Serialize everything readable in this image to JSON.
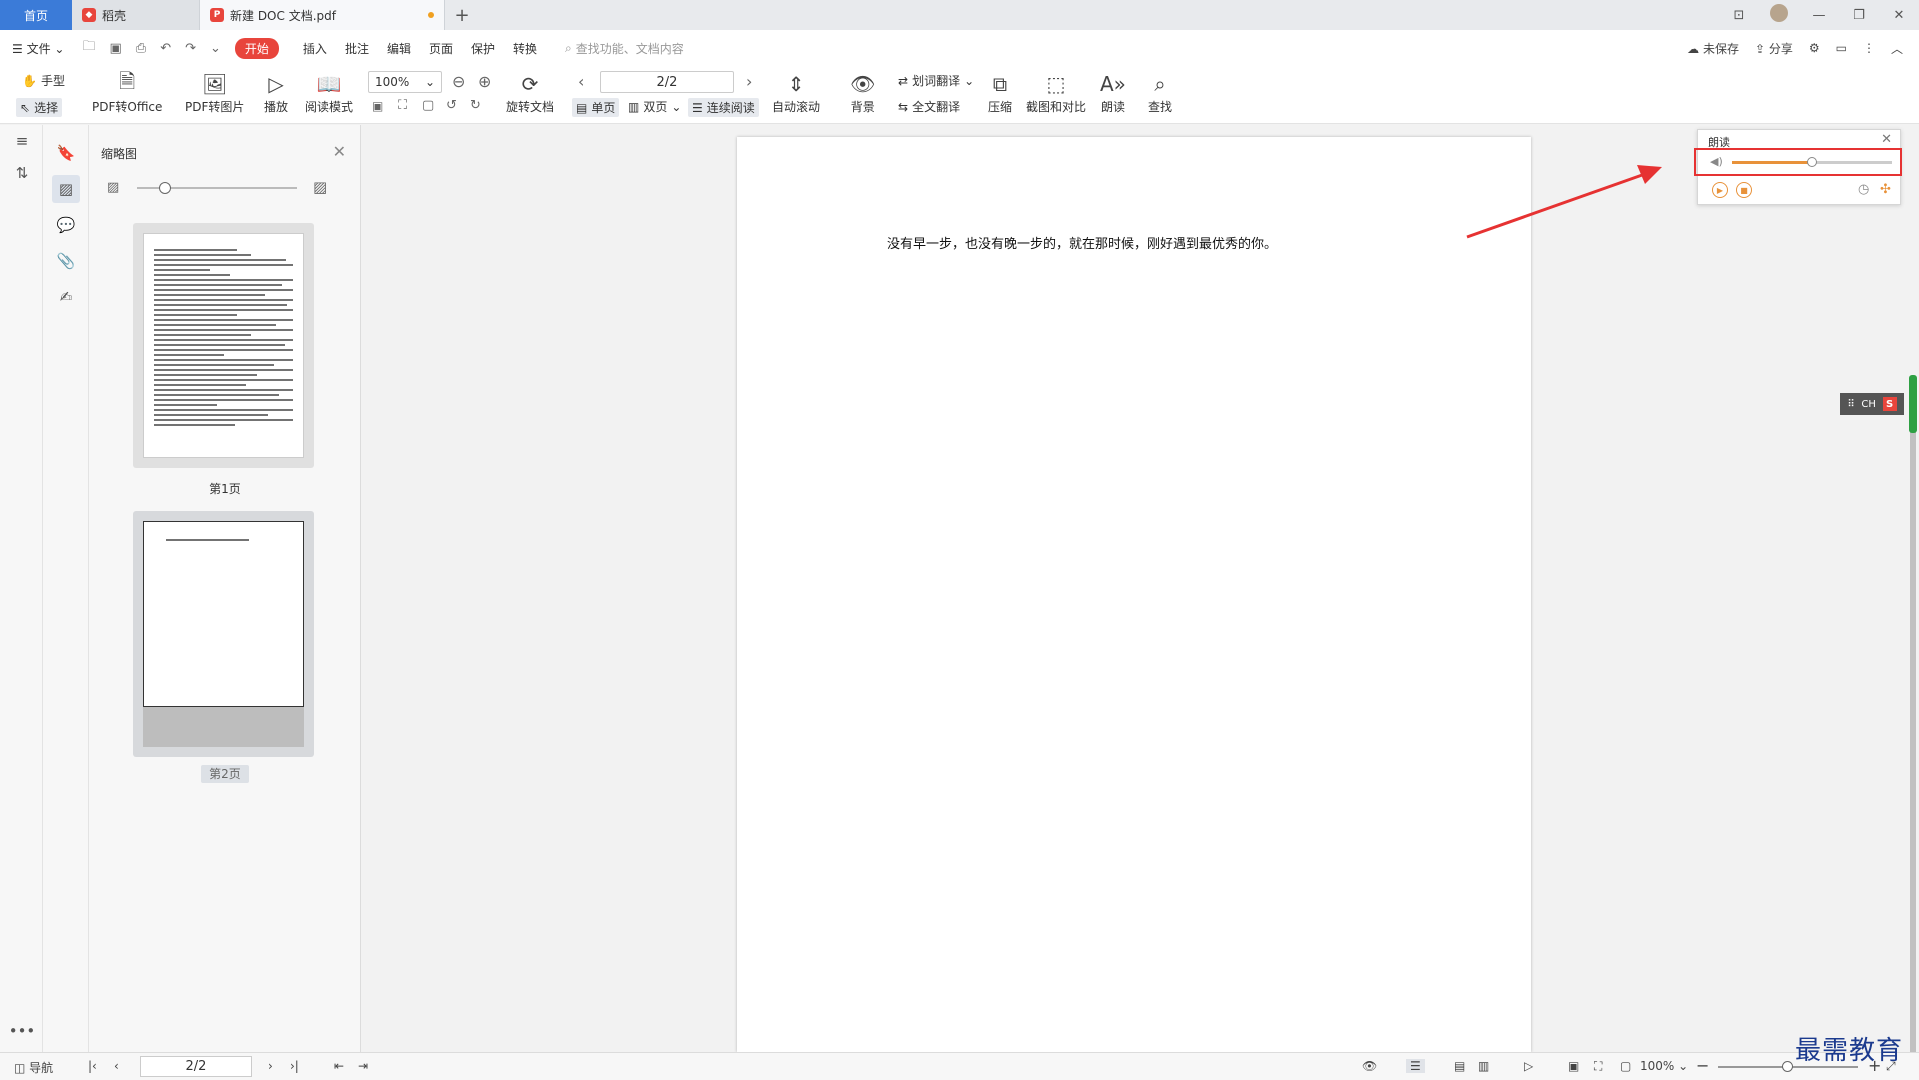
{
  "tabs": {
    "home": "首页",
    "items": [
      {
        "label": "稻壳"
      },
      {
        "label": "新建 DOC 文档.pdf"
      }
    ]
  },
  "menu": {
    "file": "文件",
    "start": "开始",
    "items": [
      "插入",
      "批注",
      "编辑",
      "页面",
      "保护",
      "转换"
    ],
    "search_placeholder": "查找功能、文档内容",
    "unsaved": "未保存",
    "share": "分享"
  },
  "ribbon": {
    "hand": "手型",
    "select": "选择",
    "pdf_to_office": "PDF转Office",
    "pdf_to_image": "PDF转图片",
    "play": "播放",
    "read_mode": "阅读模式",
    "zoom": "100%",
    "rotate_doc": "旋转文档",
    "page": "2/2",
    "single": "单页",
    "double": "双页",
    "continuous": "连续阅读",
    "auto_scroll": "自动滚动",
    "background": "背景",
    "word_translate": "划词翻译",
    "full_translate": "全文翻译",
    "compress": "压缩",
    "screenshot_compare": "截图和对比",
    "read_aloud": "朗读",
    "find": "查找"
  },
  "thumbnails": {
    "title": "缩略图",
    "pages": [
      {
        "label": "第1页"
      },
      {
        "label": "第2页"
      }
    ]
  },
  "document": {
    "text": "没有早一步，也没有晚一步的，就在那时候，刚好遇到最优秀的你。"
  },
  "read_panel": {
    "title": "朗读",
    "volume": 0.5
  },
  "ime": {
    "label": "CH",
    "logo": "S"
  },
  "statusbar": {
    "nav": "导航",
    "page": "2/2",
    "zoom": "100%"
  },
  "watermark": "最需教育",
  "colors": {
    "accent_red": "#e8453c",
    "annotation_red": "#e63232",
    "home_tab_blue": "#3b7bd8",
    "volume_orange": "#e8923a"
  }
}
